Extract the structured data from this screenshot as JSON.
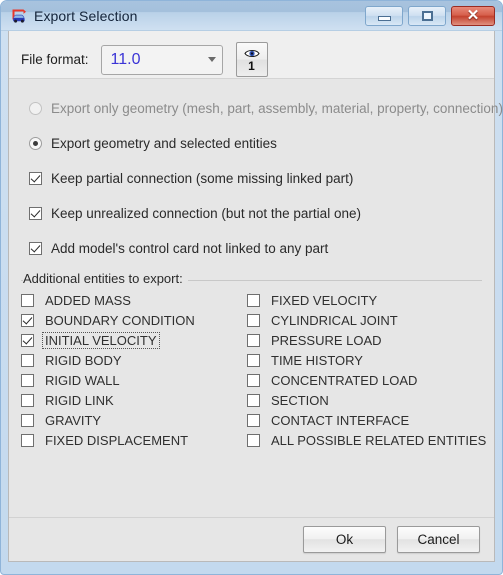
{
  "window": {
    "title": "Export Selection",
    "icon": "car-export-icon",
    "controls": {
      "minimize": "minimize-icon",
      "maximize": "maximize-icon",
      "close": "✕"
    }
  },
  "format": {
    "label": "File format:",
    "value": "11.0",
    "value_color": "#3b34d6",
    "options": [
      "11.0"
    ],
    "preview_button": {
      "icon": "eye-icon",
      "number": "1"
    }
  },
  "options": [
    {
      "type": "radio",
      "label": "Export only geometry (mesh, part, assembly, material, property, connection)",
      "checked": false,
      "disabled": true
    },
    {
      "type": "radio",
      "label": "Export geometry and selected entities",
      "checked": true,
      "disabled": false
    },
    {
      "type": "checkbox",
      "label": "Keep partial connection (some missing linked part)",
      "checked": true,
      "disabled": false
    },
    {
      "type": "checkbox",
      "label": "Keep unrealized connection (but not the partial one)",
      "checked": true,
      "disabled": false
    },
    {
      "type": "checkbox",
      "label": "Add model's control card not linked to any part",
      "checked": true,
      "disabled": false
    }
  ],
  "group": {
    "title": "Additional entities to export:",
    "left_column": [
      {
        "label": "ADDED MASS",
        "checked": false,
        "focused": false
      },
      {
        "label": "BOUNDARY CONDITION",
        "checked": true,
        "focused": false
      },
      {
        "label": "INITIAL VELOCITY",
        "checked": true,
        "focused": true
      },
      {
        "label": "RIGID BODY",
        "checked": false,
        "focused": false
      },
      {
        "label": "RIGID WALL",
        "checked": false,
        "focused": false
      },
      {
        "label": "RIGID LINK",
        "checked": false,
        "focused": false
      },
      {
        "label": "GRAVITY",
        "checked": false,
        "focused": false
      },
      {
        "label": "FIXED DISPLACEMENT",
        "checked": false,
        "focused": false
      }
    ],
    "right_column": [
      {
        "label": "FIXED VELOCITY",
        "checked": false,
        "focused": false
      },
      {
        "label": "CYLINDRICAL JOINT",
        "checked": false,
        "focused": false
      },
      {
        "label": "PRESSURE LOAD",
        "checked": false,
        "focused": false
      },
      {
        "label": "TIME HISTORY",
        "checked": false,
        "focused": false
      },
      {
        "label": "CONCENTRATED LOAD",
        "checked": false,
        "focused": false
      },
      {
        "label": "SECTION",
        "checked": false,
        "focused": false
      },
      {
        "label": "CONTACT INTERFACE",
        "checked": false,
        "focused": false
      },
      {
        "label": "ALL POSSIBLE RELATED ENTITIES",
        "checked": false,
        "focused": false
      }
    ]
  },
  "buttons": {
    "ok": "Ok",
    "cancel": "Cancel"
  }
}
